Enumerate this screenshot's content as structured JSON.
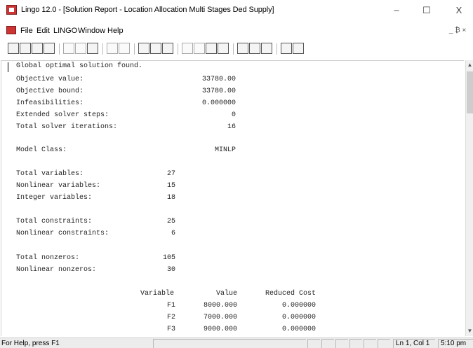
{
  "window": {
    "title": "Lingo 12.0 - [Solution Report - Location Allocation Multi Stages Ded Supply]",
    "minimize": "–",
    "maximize": "☐",
    "close": "X"
  },
  "menu": {
    "items": [
      "File",
      "Edit",
      "LINGO",
      "Window",
      "Help"
    ],
    "mdi_controls": "_ ₿ ×"
  },
  "report": {
    "header": "Global optimal solution found.",
    "stats": [
      {
        "label": "Objective value:",
        "value": "33780.00"
      },
      {
        "label": "Objective bound:",
        "value": "33780.00"
      },
      {
        "label": "Infeasibilities:",
        "value": "0.000000"
      },
      {
        "label": "Extended solver steps:",
        "value": "0"
      },
      {
        "label": "Total solver iterations:",
        "value": "16"
      }
    ],
    "model_class": {
      "label": "Model Class:",
      "value": "MINLP"
    },
    "variables": [
      {
        "label": "Total variables:",
        "value": "27"
      },
      {
        "label": "Nonlinear variables:",
        "value": "15"
      },
      {
        "label": "Integer variables:",
        "value": "18"
      }
    ],
    "constraints": [
      {
        "label": "Total constraints:",
        "value": "25"
      },
      {
        "label": "Nonlinear constraints:",
        "value": "6"
      }
    ],
    "nonzeros": [
      {
        "label": "Total nonzeros:",
        "value": "105"
      },
      {
        "label": "Nonlinear nonzeros:",
        "value": "30"
      }
    ],
    "table": {
      "headers": [
        "Variable",
        "Value",
        "Reduced Cost"
      ],
      "rows": [
        {
          "variable": "F1",
          "value": "8000.000",
          "reduced_cost": "0.000000"
        },
        {
          "variable": "F2",
          "value": "7000.000",
          "reduced_cost": "0.000000"
        },
        {
          "variable": "F3",
          "value": "9000.000",
          "reduced_cost": "0.000000"
        }
      ]
    }
  },
  "status": {
    "help": "For Help, press F1",
    "position": "Ln 1, Col 1",
    "time": "5:10 pm"
  }
}
